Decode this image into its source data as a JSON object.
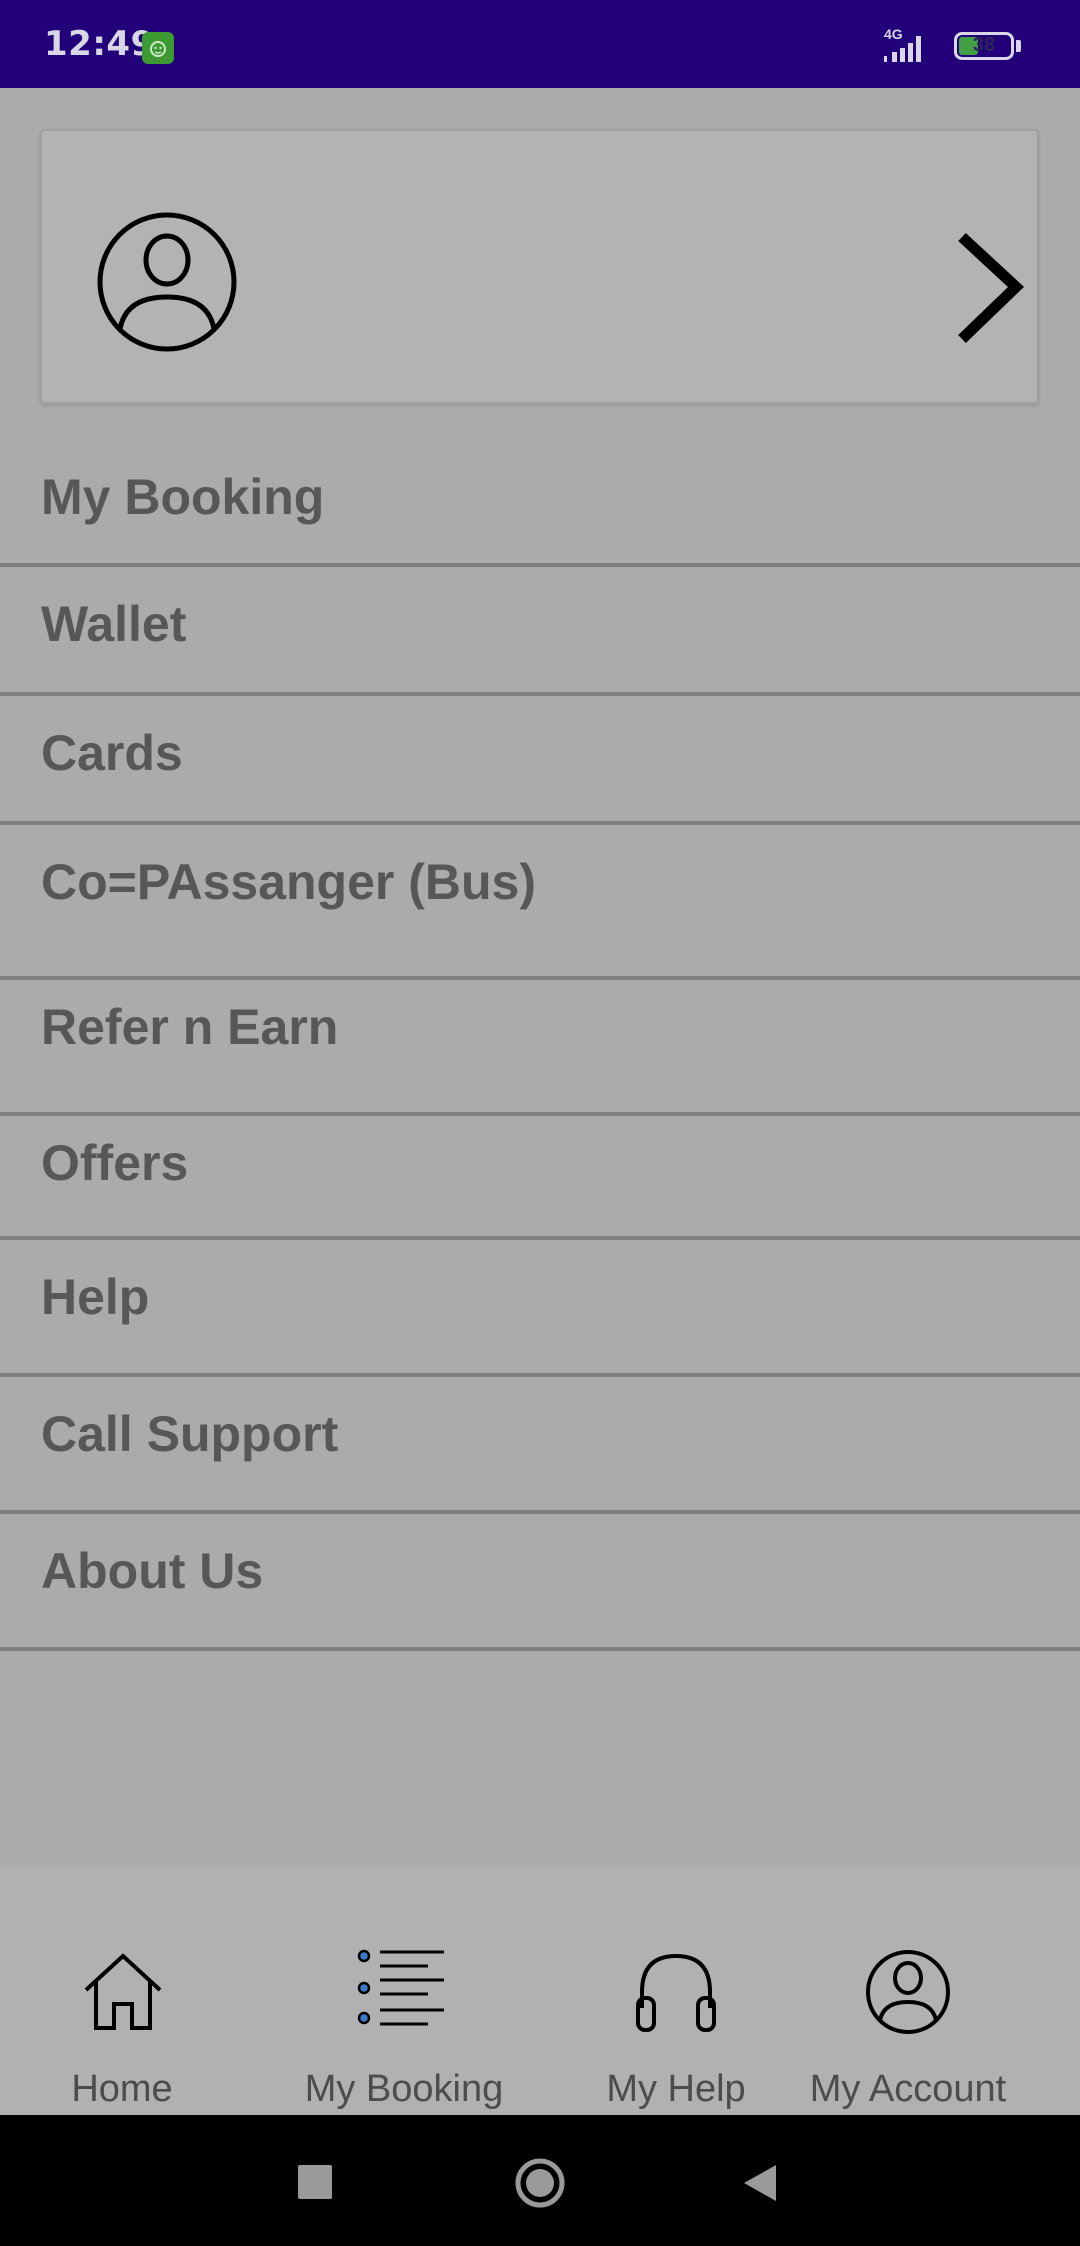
{
  "status_bar": {
    "time": "12:49",
    "network": "4G",
    "battery_level": "38",
    "battery_fraction": 0.38,
    "app_icon": "android-robot-icon",
    "background_color": "#21007a"
  },
  "profile_card": {
    "avatar_icon": "user-avatar-icon",
    "chevron_icon": "chevron-right-icon"
  },
  "menu": {
    "items": [
      {
        "label": "My Booking"
      },
      {
        "label": "Wallet"
      },
      {
        "label": "Cards"
      },
      {
        "label": "Co=PAssanger (Bus)"
      },
      {
        "label": "Refer n Earn"
      },
      {
        "label": "Offers"
      },
      {
        "label": "Help"
      },
      {
        "label": "Call Support"
      },
      {
        "label": "About Us"
      }
    ]
  },
  "bottom_nav": {
    "items": [
      {
        "label": "Home",
        "icon": "home-icon"
      },
      {
        "label": "My Booking",
        "icon": "list-icon"
      },
      {
        "label": "My Help",
        "icon": "headphones-icon"
      },
      {
        "label": "My Account",
        "icon": "account-icon"
      }
    ]
  },
  "system_nav": {
    "buttons": [
      "recents-button",
      "home-button",
      "back-button"
    ]
  }
}
